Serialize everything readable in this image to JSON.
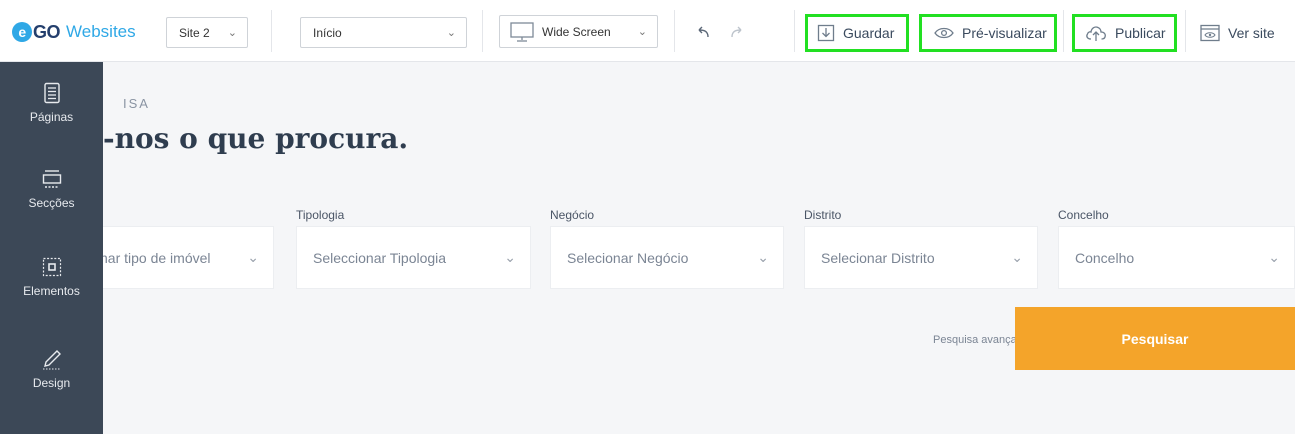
{
  "app": {
    "logo_mark": "GO",
    "logo_e": "e",
    "logo_text": "Websites"
  },
  "toolbar": {
    "site_select": "Site 2",
    "page_select": "Início",
    "view_select": "Wide Screen",
    "save_label": "Guardar",
    "preview_label": "Pré-visualizar",
    "publish_label": "Publicar",
    "view_site_label": "Ver site"
  },
  "sidebar": {
    "items": [
      {
        "label": "Páginas",
        "icon": "pages-icon"
      },
      {
        "label": "Secções",
        "icon": "sections-icon"
      },
      {
        "label": "Elementos",
        "icon": "elements-icon"
      },
      {
        "label": "Design",
        "icon": "pencil-icon"
      }
    ]
  },
  "search": {
    "kicker": "ISA",
    "headline": "-nos o que procura.",
    "fields": [
      {
        "label": "",
        "placeholder": "nar tipo de imóvel"
      },
      {
        "label": "Tipologia",
        "placeholder": "Seleccionar Tipologia"
      },
      {
        "label": "Negócio",
        "placeholder": "Selecionar Negócio"
      },
      {
        "label": "Distrito",
        "placeholder": "Selecionar Distrito"
      },
      {
        "label": "Concelho",
        "placeholder": "Concelho"
      }
    ],
    "advanced_link": "Pesquisa avançada",
    "submit_label": "Pesquisar"
  },
  "colors": {
    "accent": "#f4a42a",
    "sidebar": "#3c4857",
    "highlight": "#22e022",
    "brand": "#2fa8e6"
  }
}
